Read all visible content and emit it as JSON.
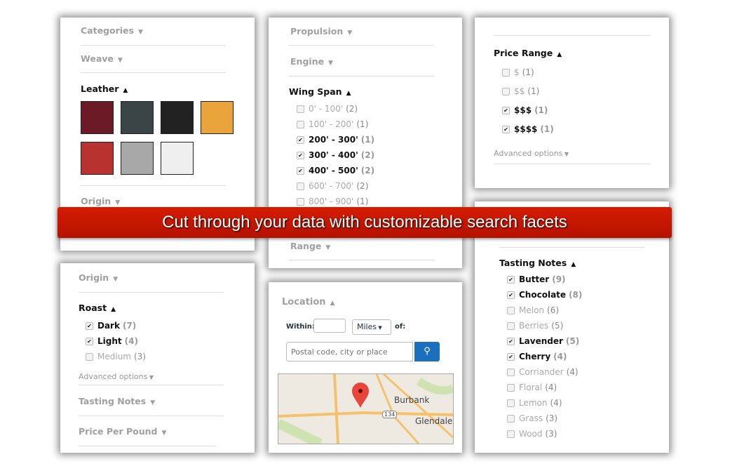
{
  "panel1": {
    "categories": "Categories",
    "weave": "Weave",
    "leather": "Leather",
    "origin": "Origin",
    "swatches": [
      "#6b1a26",
      "#3b4446",
      "#222222",
      "#e9a53b",
      "#b83230",
      "#a8a8a8",
      "#efefef"
    ]
  },
  "panel2": {
    "propulsion": "Propulsion",
    "engine": "Engine",
    "wing_span": "Wing Span",
    "range": "Range",
    "options": [
      {
        "label": "0' - 100'",
        "count": "(2)",
        "checked": false
      },
      {
        "label": "100' - 200'",
        "count": "(1)",
        "checked": false
      },
      {
        "label": "200' - 300'",
        "count": "(1)",
        "checked": true
      },
      {
        "label": "300' - 400'",
        "count": "(2)",
        "checked": true
      },
      {
        "label": "400' - 500'",
        "count": "(2)",
        "checked": true
      },
      {
        "label": "600' - 700'",
        "count": "(2)",
        "checked": false
      },
      {
        "label": "800' - 900'",
        "count": "(1)",
        "checked": false
      }
    ]
  },
  "panel3": {
    "price_range": "Price Range",
    "advanced": "Advanced options",
    "options": [
      {
        "label": "$",
        "count": "(1)",
        "checked": false
      },
      {
        "label": "$$",
        "count": "(1)",
        "checked": false
      },
      {
        "label": "$$$",
        "count": "(1)",
        "checked": true
      },
      {
        "label": "$$$$",
        "count": "(1)",
        "checked": true
      }
    ]
  },
  "panel4": {
    "tasting_notes": "Tasting Notes",
    "options": [
      {
        "label": "Butter",
        "count": "(9)",
        "checked": true
      },
      {
        "label": "Chocolate",
        "count": "(8)",
        "checked": true
      },
      {
        "label": "Melon",
        "count": "(6)",
        "checked": false
      },
      {
        "label": "Berries",
        "count": "(5)",
        "checked": false
      },
      {
        "label": "Lavender",
        "count": "(5)",
        "checked": true
      },
      {
        "label": "Cherry",
        "count": "(4)",
        "checked": true
      },
      {
        "label": "Corriander",
        "count": "(4)",
        "checked": false
      },
      {
        "label": "Floral",
        "count": "(4)",
        "checked": false
      },
      {
        "label": "Lemon",
        "count": "(4)",
        "checked": false
      },
      {
        "label": "Grass",
        "count": "(3)",
        "checked": false
      },
      {
        "label": "Wood",
        "count": "(3)",
        "checked": false
      }
    ]
  },
  "panel5": {
    "origin": "Origin",
    "roast": "Roast",
    "advanced": "Advanced options",
    "tasting_notes": "Tasting Notes",
    "price_per_pound": "Price Per Pound",
    "options": [
      {
        "label": "Dark",
        "count": "(7)",
        "checked": true
      },
      {
        "label": "Light",
        "count": "(4)",
        "checked": true
      },
      {
        "label": "Medium",
        "count": "(3)",
        "checked": false
      }
    ]
  },
  "panel6": {
    "location": "Location",
    "within": "Within:",
    "within_value": "",
    "unit": "Miles",
    "of": "of:",
    "place_placeholder": "Postal code, city or place",
    "map_labels": {
      "burbank": "Burbank",
      "glendale": "Glendale",
      "route": "134"
    }
  },
  "banner": "Cut through your data with customizable search facets"
}
